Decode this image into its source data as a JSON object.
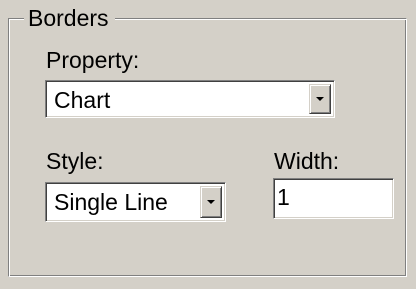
{
  "borders_group": {
    "title": "Borders",
    "property": {
      "label": "Property:",
      "value": "Chart"
    },
    "style": {
      "label": "Style:",
      "value": "Single Line"
    },
    "width": {
      "label": "Width:",
      "value": "1"
    }
  },
  "icons": {
    "dropdown": "chevron-down-icon"
  },
  "colors": {
    "dialog_background": "#d4d0c8",
    "field_background": "#ffffff",
    "shadow": "#808080",
    "highlight": "#ffffff"
  }
}
